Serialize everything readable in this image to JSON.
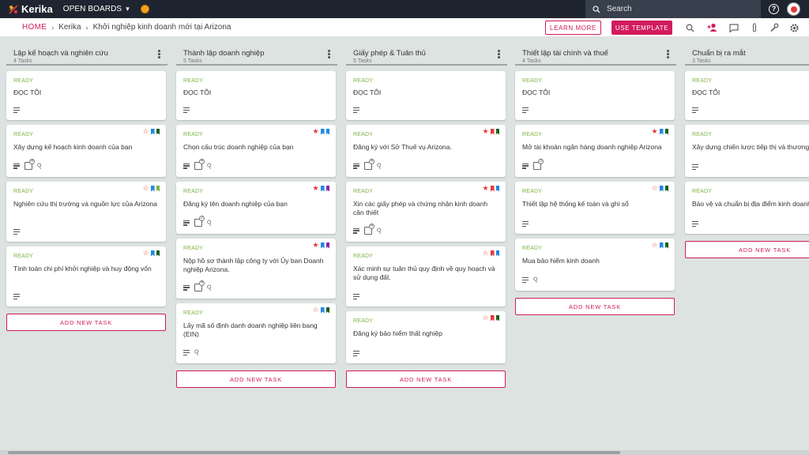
{
  "topbar": {
    "logo_text": "Kerika",
    "open_boards_label": "OPEN BOARDS",
    "search_placeholder": "Search"
  },
  "breadcrumb": {
    "home": "HOME",
    "org": "Kerika",
    "board": "Khởi nghiệp kinh doanh mới tại Arizona"
  },
  "actions": {
    "learn_more": "LEARN MORE",
    "use_template": "USE TEMPLATE"
  },
  "add_task_label": "ADD NEW TASK",
  "colors": {
    "accent": "#d11b5c",
    "ready": "#7cb342",
    "topbar": "#1f2530",
    "board_bg": "#dde3e1"
  },
  "columns": [
    {
      "title": "Lập kế hoạch và nghiên cứu",
      "count": "4 Tasks",
      "cards": [
        {
          "status": "READY",
          "title": "ĐỌC TÔI",
          "star": "none",
          "flags": [],
          "checklist": false,
          "attach": false
        },
        {
          "status": "READY",
          "title": "Xây dựng kế hoạch kinh doanh của bạn",
          "star": "empty",
          "flags": [
            "#1e88e5",
            "#1b5e20"
          ],
          "checklist": true,
          "checklist_count": "4",
          "attach": true
        },
        {
          "status": "READY",
          "title": "Nghiên cứu thị trường và nguồn lực của Arizona",
          "star": "empty",
          "flags": [
            "#1e88e5",
            "#7cb342"
          ],
          "checklist": false,
          "attach": false
        },
        {
          "status": "READY",
          "title": "Tính toán chi phí khởi nghiệp và huy động vốn",
          "star": "empty",
          "flags": [
            "#1e88e5",
            "#1b5e20"
          ],
          "checklist": false,
          "attach": false
        }
      ]
    },
    {
      "title": "Thành lập doanh nghiệp",
      "count": "5 Tasks",
      "cards": [
        {
          "status": "READY",
          "title": "ĐỌC TÔI",
          "star": "none",
          "flags": [],
          "checklist": false,
          "attach": false
        },
        {
          "status": "READY",
          "title": "Chọn cấu trúc doanh nghiệp của bạn",
          "star": "filled",
          "flags": [
            "#1e88e5",
            "#1e88e5"
          ],
          "checklist": true,
          "checklist_count": "4",
          "attach": true
        },
        {
          "status": "READY",
          "title": "Đăng ký tên doanh nghiệp của bạn",
          "star": "filled",
          "flags": [
            "#1e88e5",
            "#8e24aa"
          ],
          "checklist": true,
          "checklist_count": "2",
          "attach": true
        },
        {
          "status": "READY",
          "title": "Nộp hồ sơ thành lập công ty với Ủy ban Doanh nghiệp Arizona.",
          "star": "filled",
          "flags": [
            "#1e88e5",
            "#8e24aa"
          ],
          "checklist": true,
          "checklist_count": "4",
          "attach": true
        },
        {
          "status": "READY",
          "title": "Lấy mã số định danh doanh nghiệp liên bang (EIN)",
          "star": "empty",
          "flags": [
            "#1e88e5",
            "#1b5e20"
          ],
          "checklist": false,
          "attach": true
        }
      ]
    },
    {
      "title": "Giấy phép & Tuân thủ",
      "count": "5 Tasks",
      "cards": [
        {
          "status": "READY",
          "title": "ĐỌC TÔI",
          "star": "none",
          "flags": [],
          "checklist": false,
          "attach": false
        },
        {
          "status": "READY",
          "title": "Đăng ký với Sở Thuế vụ Arizona.",
          "star": "filled",
          "flags": [
            "#e53935",
            "#1b5e20"
          ],
          "checklist": true,
          "checklist_count": "4",
          "attach": true
        },
        {
          "status": "READY",
          "title": "Xin các giấy phép và chứng nhận kinh doanh cần thiết",
          "star": "filled",
          "flags": [
            "#e53935",
            "#1e88e5"
          ],
          "checklist": true,
          "checklist_count": "4",
          "attach": true
        },
        {
          "status": "READY",
          "title": "Xác minh sự tuân thủ quy định về quy hoạch và sử dụng đất.",
          "star": "empty",
          "flags": [
            "#e53935",
            "#1e88e5"
          ],
          "checklist": false,
          "attach": false
        },
        {
          "status": "READY",
          "title": "Đăng ký bảo hiểm thất nghiệp",
          "star": "empty",
          "flags": [
            "#e53935",
            "#1b5e20"
          ],
          "checklist": false,
          "attach": false
        }
      ]
    },
    {
      "title": "Thiết lập tài chính và thuế",
      "count": "4 Tasks",
      "cards": [
        {
          "status": "READY",
          "title": "ĐỌC TÔI",
          "star": "none",
          "flags": [],
          "checklist": false,
          "attach": false
        },
        {
          "status": "READY",
          "title": "Mở tài khoản ngân hàng doanh nghiệp Arizona",
          "star": "filled",
          "flags": [
            "#1e88e5",
            "#1b5e20"
          ],
          "checklist": true,
          "checklist_count": "3",
          "attach": false
        },
        {
          "status": "READY",
          "title": "Thiết lập hệ thống kế toán và ghi sổ",
          "star": "empty",
          "flags": [
            "#1e88e5",
            "#1b5e20"
          ],
          "checklist": false,
          "attach": false
        },
        {
          "status": "READY",
          "title": "Mua bảo hiểm kinh doanh",
          "star": "empty",
          "flags": [
            "#1e88e5",
            "#1b5e20"
          ],
          "checklist": false,
          "attach": true
        }
      ]
    },
    {
      "title": "Chuẩn bị ra mắt",
      "count": "3 Tasks",
      "cards": [
        {
          "status": "READY",
          "title": "ĐỌC TÔI",
          "star": "none",
          "flags": [],
          "checklist": false,
          "attach": false
        },
        {
          "status": "READY",
          "title": "Xây dựng chiến lược tiếp thị và thương hiệu",
          "star": "none",
          "flags": [],
          "checklist": false,
          "attach": false
        },
        {
          "status": "READY",
          "title": "Bảo vệ và chuẩn bị địa điểm kinh doanh",
          "star": "none",
          "flags": [],
          "checklist": false,
          "attach": false
        }
      ]
    }
  ]
}
